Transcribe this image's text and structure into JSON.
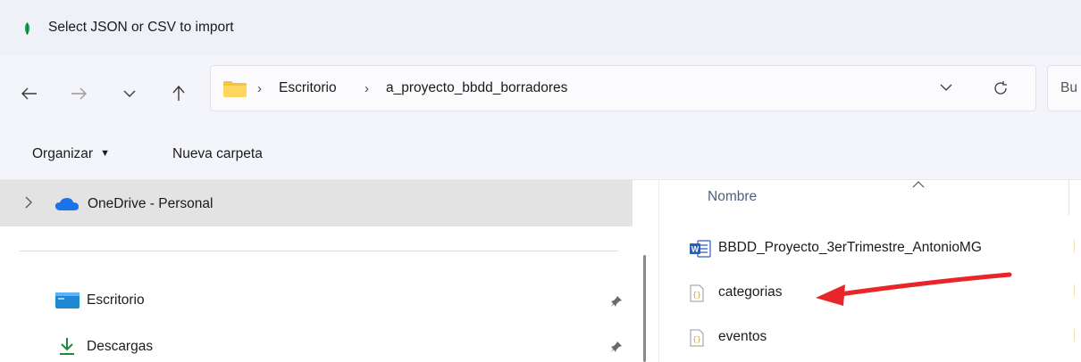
{
  "window": {
    "title": "Select JSON or CSV to import"
  },
  "nav": {
    "back": "back-arrow-icon",
    "forward": "forward-arrow-icon",
    "recent": "chevron-down-icon",
    "up": "up-arrow-icon"
  },
  "address": {
    "breadcrumbs": [
      "Escritorio",
      "a_proyecto_bbdd_borradores"
    ],
    "separator": "›"
  },
  "search": {
    "placeholder_partial": "Bu"
  },
  "commands": {
    "organize": "Organizar",
    "new_folder": "Nueva carpeta"
  },
  "sidebar": {
    "onedrive": "OneDrive - Personal",
    "items": [
      {
        "label": "Escritorio",
        "icon": "desktop-folder-icon",
        "pinned": true
      },
      {
        "label": "Descargas",
        "icon": "download-arrow-icon",
        "pinned": true
      }
    ]
  },
  "file_list": {
    "column_name": "Nombre",
    "files": [
      {
        "name": "BBDD_Proyecto_3erTrimestre_AntonioMG",
        "icon": "word-document-icon"
      },
      {
        "name": "categorias",
        "icon": "json-file-icon"
      },
      {
        "name": "eventos",
        "icon": "json-file-icon"
      }
    ]
  },
  "colors": {
    "accent_arrow": "#e8262a",
    "selection_bg": "#e3e3e3",
    "folder": "#f5c342",
    "word_blue": "#2b5fb4"
  }
}
